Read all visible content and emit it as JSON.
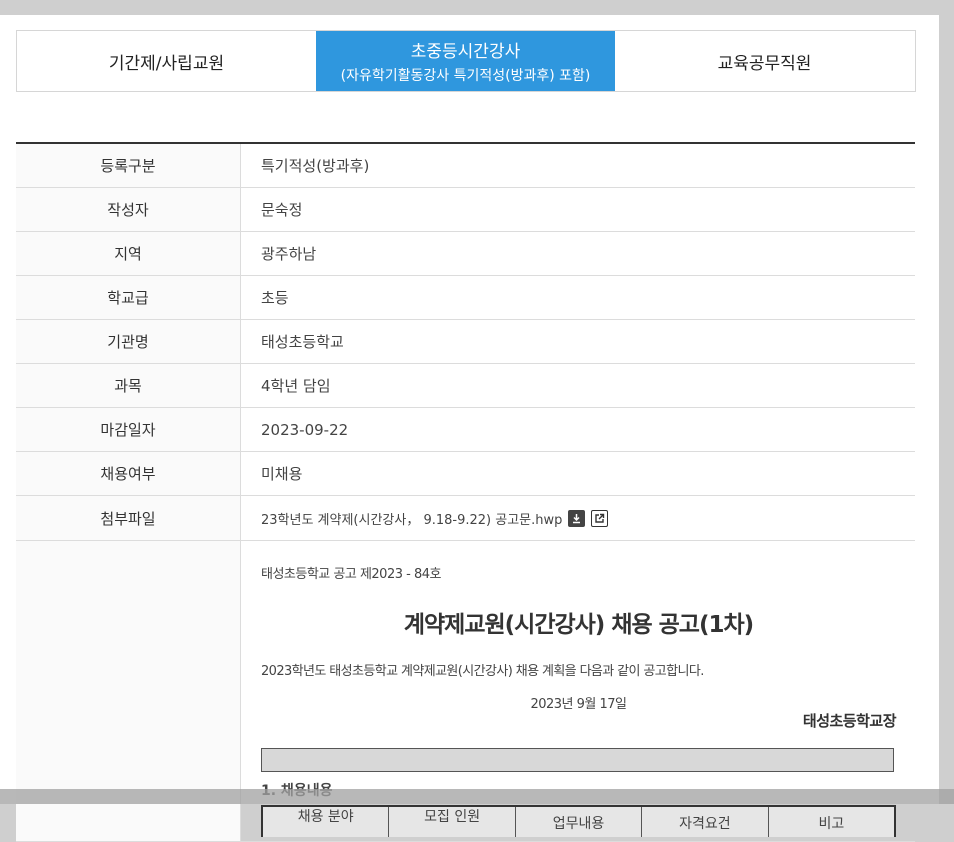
{
  "tabs": [
    {
      "label": "기간제/사립교원",
      "sub": ""
    },
    {
      "label": "초중등시간강사",
      "sub": "(자유학기활동강사 특기적성(방과후) 포함)"
    },
    {
      "label": "교육공무직원",
      "sub": ""
    }
  ],
  "info": {
    "category": {
      "label": "등록구분",
      "value": "특기적성(방과후)"
    },
    "author": {
      "label": "작성자",
      "value": "문숙정"
    },
    "region": {
      "label": "지역",
      "value": "광주하남"
    },
    "school_level": {
      "label": "학교급",
      "value": "초등"
    },
    "institution": {
      "label": "기관명",
      "value": "태성초등학교"
    },
    "subject": {
      "label": "과목",
      "value": "4학년 담임"
    },
    "deadline": {
      "label": "마감일자",
      "value": "2023-09-22"
    },
    "hired": {
      "label": "채용여부",
      "value": "미채용"
    },
    "attachment": {
      "label": "첨부파일",
      "value": "23학년도 계약제(시간강사， 9.18-9.22) 공고문.hwp"
    }
  },
  "doc": {
    "notice_no": "태성초등학교 공고 제2023 - 84호",
    "title": "계약제교원(시간강사) 채용 공고(1차)",
    "lead": "2023학년도 태성초등학교 계약제교원(시간강사) 채용 계획을 다음과 같이 공고합니다.",
    "date": "2023년 9월 17일",
    "signer": "태성초등학교장",
    "section1": "1. 채용내용",
    "table_headers": [
      "채용 분야",
      "모집 인원",
      "업무내용",
      "자격요건",
      "비고"
    ]
  },
  "icons": {
    "download": "download-icon",
    "open": "external-link-icon"
  },
  "colors": {
    "active_tab": "#2f97de"
  }
}
